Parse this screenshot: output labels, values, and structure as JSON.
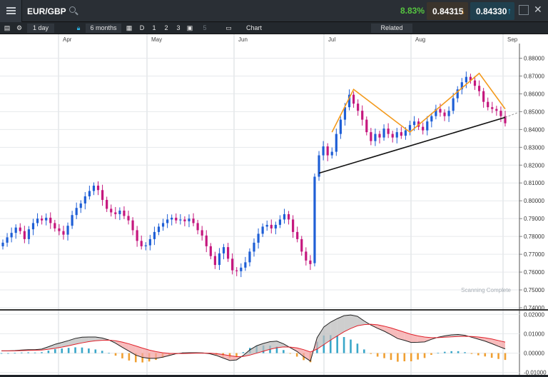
{
  "header": {
    "symbol": "EUR/GBP",
    "change_pct": "8.83%",
    "sell_price": "0.84315",
    "buy_price": "0.84330"
  },
  "toolbar": {
    "interval": "1 day",
    "period": "6 months",
    "day_label": "D",
    "d1": "1",
    "d2": "2",
    "d3": "3",
    "d5": "5",
    "forum": "Chart Forum",
    "related": "Related"
  },
  "status_text": "Scanning Complete",
  "colors": {
    "up": "#1f5fd6",
    "down": "#c5177e",
    "pattern": "#f39a1d",
    "trend": "#111111",
    "macd_up": "#3aa7c9",
    "macd_down": "#f0a033"
  },
  "chart_data": {
    "type": "candlestick",
    "months": [
      "Apr",
      "May",
      "Jun",
      "Jul",
      "Aug",
      "Sep"
    ],
    "y_ticks": [
      "0.88000",
      "0.87000",
      "0.86000",
      "0.85000",
      "0.84000",
      "0.83000",
      "0.82000",
      "0.81000",
      "0.80000",
      "0.79000",
      "0.78000",
      "0.77000",
      "0.76000",
      "0.75000",
      "0.74000"
    ],
    "ylim": [
      0.74,
      0.882
    ],
    "closes": [
      0.7765,
      0.7795,
      0.782,
      0.785,
      0.783,
      0.7785,
      0.784,
      0.7875,
      0.79,
      0.789,
      0.7905,
      0.7875,
      0.7845,
      0.783,
      0.781,
      0.786,
      0.792,
      0.796,
      0.7985,
      0.8025,
      0.8055,
      0.8085,
      0.806,
      0.8005,
      0.7955,
      0.7935,
      0.7925,
      0.7945,
      0.7915,
      0.789,
      0.7835,
      0.7775,
      0.7745,
      0.775,
      0.7785,
      0.7825,
      0.7855,
      0.7875,
      0.7895,
      0.7905,
      0.789,
      0.7895,
      0.7885,
      0.79,
      0.7875,
      0.7835,
      0.7805,
      0.7745,
      0.769,
      0.764,
      0.7705,
      0.774,
      0.7675,
      0.761,
      0.7605,
      0.7625,
      0.7655,
      0.7715,
      0.7765,
      0.7815,
      0.7855,
      0.7865,
      0.7845,
      0.7865,
      0.7895,
      0.7925,
      0.7895,
      0.7825,
      0.7785,
      0.7715,
      0.7665,
      0.7645,
      0.8135,
      0.8255,
      0.8305,
      0.8255,
      0.8275,
      0.8375,
      0.8455,
      0.8525,
      0.8595,
      0.8545,
      0.8505,
      0.8455,
      0.8385,
      0.8335,
      0.8375,
      0.8355,
      0.8405,
      0.8375,
      0.8355,
      0.8385,
      0.8365,
      0.8395,
      0.8425,
      0.8445,
      0.8415,
      0.8395,
      0.8445,
      0.8475,
      0.8515,
      0.8495,
      0.8475,
      0.8505,
      0.8575,
      0.8625,
      0.8665,
      0.8695,
      0.8675,
      0.8645,
      0.8615,
      0.8555,
      0.8525,
      0.8515,
      0.8505,
      0.8475,
      0.8435
    ],
    "macd_line": [
      0.0012,
      0.0012,
      0.0013,
      0.0016,
      0.0018,
      0.0018,
      0.0021,
      0.0033,
      0.0046,
      0.0055,
      0.0065,
      0.0076,
      0.0082,
      0.0083,
      0.0083,
      0.0078,
      0.0068,
      0.0051,
      0.003,
      0.001,
      -0.001,
      -0.0022,
      -0.0027,
      -0.0027,
      -0.0021,
      -0.0012,
      -0.0003,
      0.0001,
      0.0002,
      0.0002,
      0.0001,
      -0.0003,
      -0.0012,
      -0.0025,
      -0.0038,
      -0.0035,
      -0.0012,
      0.0017,
      0.0038,
      0.005,
      0.0059,
      0.0062,
      0.0048,
      0.0028,
      0.0009,
      -0.0018,
      -0.0041,
      0.008,
      0.0135,
      0.016,
      0.0178,
      0.0193,
      0.0197,
      0.019,
      0.0166,
      0.0145,
      0.0128,
      0.0113,
      0.0095,
      0.0075,
      0.0066,
      0.0055,
      0.0056,
      0.0058,
      0.0071,
      0.0082,
      0.0089,
      0.0094,
      0.0096,
      0.0092,
      0.0082,
      0.0072,
      0.0062,
      0.0049,
      0.0035,
      0.0022
    ],
    "signal_line": [
      0.0012,
      0.0012,
      0.0012,
      0.0013,
      0.0014,
      0.0015,
      0.0016,
      0.002,
      0.0025,
      0.0031,
      0.0038,
      0.0046,
      0.0053,
      0.0059,
      0.0064,
      0.0066,
      0.0067,
      0.0064,
      0.0057,
      0.0048,
      0.0037,
      0.0026,
      0.0016,
      0.0008,
      0.0002,
      -0.0001,
      -0.0002,
      -0.0002,
      -0.0001,
      0,
      0,
      0,
      -0.0003,
      -0.0007,
      -0.0013,
      -0.0018,
      -0.0017,
      -0.001,
      0.0,
      0.001,
      0.002,
      0.0028,
      0.0032,
      0.0031,
      0.0027,
      0.0018,
      0.0006,
      0.0021,
      0.0044,
      0.0067,
      0.0089,
      0.011,
      0.0127,
      0.0141,
      0.0147,
      0.0149,
      0.0146,
      0.0139,
      0.013,
      0.0119,
      0.0108,
      0.0097,
      0.0089,
      0.0083,
      0.008,
      0.008,
      0.0082,
      0.0084,
      0.0086,
      0.0087,
      0.0086,
      0.0083,
      0.0079,
      0.0073,
      0.0065,
      0.0057
    ],
    "macd_ticks": [
      "0.02000",
      "0.01000",
      "0.00000",
      "-0.01000"
    ],
    "macd_ylim": [
      -0.0112,
      0.0212
    ]
  }
}
